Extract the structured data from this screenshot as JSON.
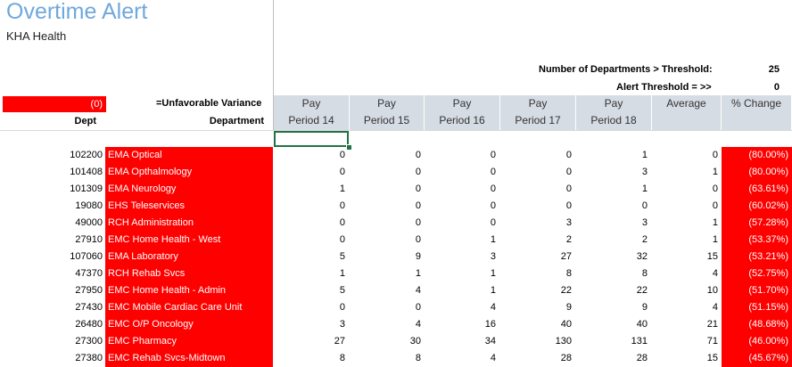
{
  "title": "Overtime Alert",
  "subtitle": "KHA Health",
  "threshold": {
    "departments_label": "Number of Departments > Threshold:",
    "departments_value": "25",
    "alert_label": "Alert Threshold = >>",
    "alert_value": "0"
  },
  "variance": {
    "value": "(0)",
    "label": "=Unfavorable Variance"
  },
  "headers": {
    "dept": "Dept",
    "department": "Department",
    "columns": [
      {
        "line1": "Pay",
        "line2": "Period 14"
      },
      {
        "line1": "Pay",
        "line2": "Period 15"
      },
      {
        "line1": "Pay",
        "line2": "Period 16"
      },
      {
        "line1": "Pay",
        "line2": "Period 17"
      },
      {
        "line1": "Pay",
        "line2": "Period 18"
      },
      {
        "line1": "",
        "line2": "Average"
      },
      {
        "line1": "",
        "line2": "% Change"
      }
    ]
  },
  "rows": [
    {
      "dept": "102200",
      "name": "EMA Optical",
      "p14": "0",
      "p15": "0",
      "p16": "0",
      "p17": "0",
      "p18": "1",
      "avg": "0",
      "pct": "(80.00%)"
    },
    {
      "dept": "101408",
      "name": "EMA Opthalmology",
      "p14": "0",
      "p15": "0",
      "p16": "0",
      "p17": "0",
      "p18": "3",
      "avg": "1",
      "pct": "(80.00%)"
    },
    {
      "dept": "101309",
      "name": "EMA Neurology",
      "p14": "1",
      "p15": "0",
      "p16": "0",
      "p17": "0",
      "p18": "1",
      "avg": "0",
      "pct": "(63.61%)"
    },
    {
      "dept": "19080",
      "name": "EHS Teleservices",
      "p14": "0",
      "p15": "0",
      "p16": "0",
      "p17": "0",
      "p18": "0",
      "avg": "0",
      "pct": "(60.02%)"
    },
    {
      "dept": "49000",
      "name": "RCH Administration",
      "p14": "0",
      "p15": "0",
      "p16": "0",
      "p17": "3",
      "p18": "3",
      "avg": "1",
      "pct": "(57.28%)"
    },
    {
      "dept": "27910",
      "name": "EMC Home Health - West",
      "p14": "0",
      "p15": "0",
      "p16": "1",
      "p17": "2",
      "p18": "2",
      "avg": "1",
      "pct": "(53.37%)"
    },
    {
      "dept": "107060",
      "name": "EMA Laboratory",
      "p14": "5",
      "p15": "9",
      "p16": "3",
      "p17": "27",
      "p18": "32",
      "avg": "15",
      "pct": "(53.21%)"
    },
    {
      "dept": "47370",
      "name": "RCH Rehab Svcs",
      "p14": "1",
      "p15": "1",
      "p16": "1",
      "p17": "8",
      "p18": "8",
      "avg": "4",
      "pct": "(52.75%)"
    },
    {
      "dept": "27950",
      "name": "EMC Home Health - Admin",
      "p14": "5",
      "p15": "4",
      "p16": "1",
      "p17": "22",
      "p18": "22",
      "avg": "10",
      "pct": "(51.70%)"
    },
    {
      "dept": "27430",
      "name": "EMC Mobile Cardiac Care Unit",
      "p14": "0",
      "p15": "0",
      "p16": "4",
      "p17": "9",
      "p18": "9",
      "avg": "4",
      "pct": "(51.15%)"
    },
    {
      "dept": "26480",
      "name": "EMC O/P Oncology",
      "p14": "3",
      "p15": "4",
      "p16": "16",
      "p17": "40",
      "p18": "40",
      "avg": "21",
      "pct": "(48.68%)"
    },
    {
      "dept": "27300",
      "name": "EMC Pharmacy",
      "p14": "27",
      "p15": "30",
      "p16": "34",
      "p17": "130",
      "p18": "131",
      "avg": "71",
      "pct": "(46.00%)"
    },
    {
      "dept": "27380",
      "name": "EMC Rehab Svcs-Midtown",
      "p14": "8",
      "p15": "8",
      "p16": "4",
      "p17": "28",
      "p18": "28",
      "avg": "15",
      "pct": "(45.67%)"
    }
  ]
}
